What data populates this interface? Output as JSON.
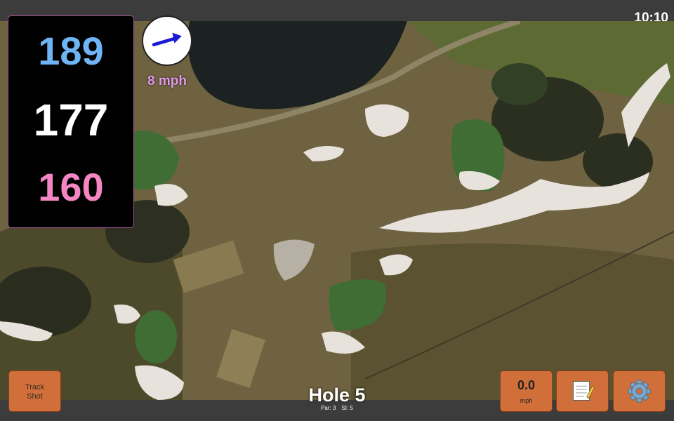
{
  "status_bar": {
    "time": "10:10"
  },
  "distances": {
    "back": "189",
    "middle": "177",
    "front": "160"
  },
  "wind": {
    "speed_label": "8 mph",
    "direction_icon": "arrow-icon"
  },
  "hole": {
    "title": "Hole 5",
    "par": "Par: 3",
    "stroke_index": "SI: 5"
  },
  "buttons": {
    "track_shot_line1": "Track",
    "track_shot_line2": "Shot",
    "wind_value": "0.0",
    "wind_unit": "mph",
    "notes_icon": "notepad-icon",
    "settings_icon": "gear-icon"
  },
  "colors": {
    "back_distance": "#6fb4f5",
    "middle_distance": "#ffffff",
    "front_distance": "#f486c4",
    "wind_label": "#e49be8",
    "button_bg": "#d16f3a"
  }
}
